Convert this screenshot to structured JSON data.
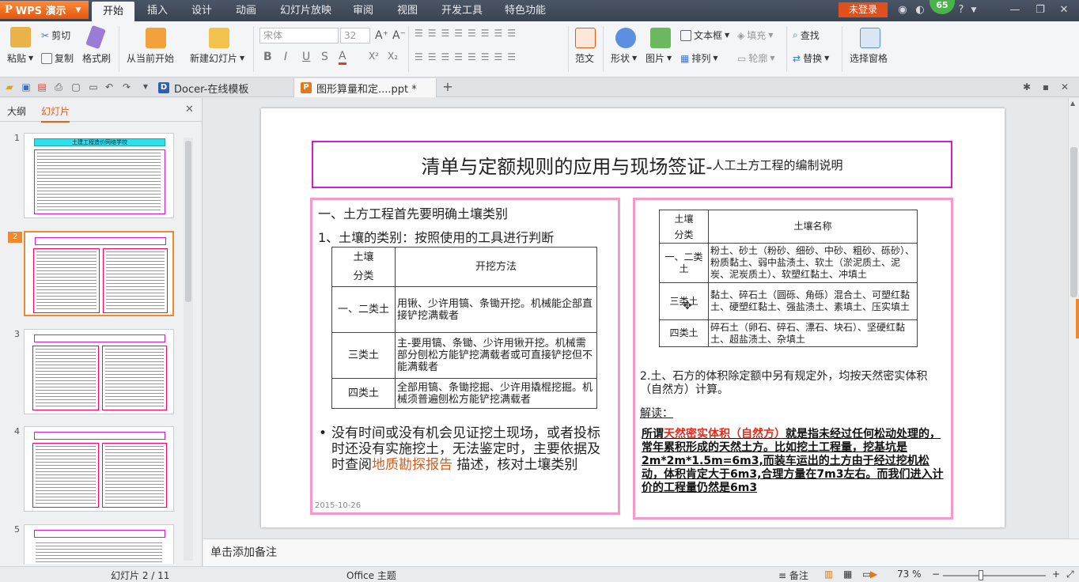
{
  "app": {
    "name": "WPS 演示",
    "login": "未登录",
    "badge_count": "65",
    "help": "?"
  },
  "menu": [
    "开始",
    "插入",
    "设计",
    "动画",
    "幻灯片放映",
    "审阅",
    "视图",
    "开发工具",
    "特色功能"
  ],
  "ribbon": {
    "paste": "粘贴",
    "cut": "剪切",
    "copy": "复制",
    "format_painter": "格式刷",
    "from_current": "从当前开始",
    "new_slide": "新建幻灯片",
    "font_name": "宋体",
    "font_size": "32",
    "template": "范文",
    "shape": "形状",
    "picture": "图片",
    "textbox": "文本框",
    "fill": "填充",
    "arrange": "排列",
    "outline": "轮廓",
    "find": "查找",
    "replace": "替换",
    "selection_pane": "选择窗格"
  },
  "tabs": [
    {
      "label": "Docer-在线模板"
    },
    {
      "label": "图形算量和定....ppt *"
    }
  ],
  "left_panel": {
    "tab_outline": "大纲",
    "tab_slides": "幻灯片",
    "thumb1_title": "土建工程造价网络学校",
    "slide_numbers": [
      "1",
      "2",
      "3",
      "4",
      "5"
    ]
  },
  "slide": {
    "title_main": "清单与定额规则的应用与现场签证-",
    "title_sub": "人工土方工程的编制说明",
    "left": {
      "heading1": "一、土方工程首先要明确土壤类别",
      "heading2": "1、土壤的类别：按照使用的工具进行判断",
      "table_head_cat_top": "土壤",
      "table_head_cat_bottom": "分类",
      "table_head_method": "开挖方法",
      "rows": [
        {
          "cat": "一、二类土",
          "method": "用锹、少许用镐、条锄开挖。机械能企部直接铲挖满载者"
        },
        {
          "cat": "三类土",
          "method": "主-要用镐、条锄、少许用锹开挖。机械需部分刨松方能铲挖满载者或可直接铲挖但不能满载者"
        },
        {
          "cat": "四类土",
          "method": "全部用镐、条锄挖掘、少许用撬棍挖掘。机械须普遍刨松方能铲挖满载者"
        }
      ],
      "bullet_before": "没有时间或没有机会见证挖土现场，或者投标时还没有实施挖土，无法鉴定时，主要依据及时查阅",
      "bullet_highlight": "地质勘探报告",
      "bullet_after": " 描述，核对土壤类别",
      "date": "2015-10-26"
    },
    "right": {
      "table_head_cat_top": "土壤",
      "table_head_cat_bottom": "分类",
      "table_head_name": "土壤名称",
      "rows": [
        {
          "cat": "一、二类土",
          "name": "粉土、砂土（粉砂、细砂、中砂、粗砂、砾砂）、粉质黏土、弱中盐渍土、软土（淤泥质土、泥炭、泥炭质土）、软塑红黏土、冲填土"
        },
        {
          "cat": "三类土",
          "name": "黏土、碎石土（圆砾、角砾）混合土、可塑红黏土、硬塑红黏土、强盐渍土、素填土、压实填土"
        },
        {
          "cat": "四类土",
          "name": "碎石土（卵石、碎石、漂石、块石）、坚硬红黏土、超盐渍土、杂填土"
        }
      ],
      "para": "2.土、石方的体积除定额中另有规定外，均按天然密实体积（自然方）计算。",
      "interpret_label": "解读：",
      "interpret_before": "所谓",
      "interpret_red": "天然密实体积（自然方）",
      "interpret_after": "就是指未经过任何松动处理的，常年累积形成的天然土方。比如挖土工程量，挖基坑是2m*2m*1.5m=6m3,而装车运出的土方由于经过挖机松动，体积肯定大于6m3,合理方量在7m3左右。而我们进入计价的工程量仍然是6m3"
    }
  },
  "notes_placeholder": "单击添加备注",
  "status": {
    "slide_counter": "幻灯片 2 / 11",
    "theme": "Office 主题",
    "notes_btn": "备注",
    "zoom": "73 %"
  }
}
